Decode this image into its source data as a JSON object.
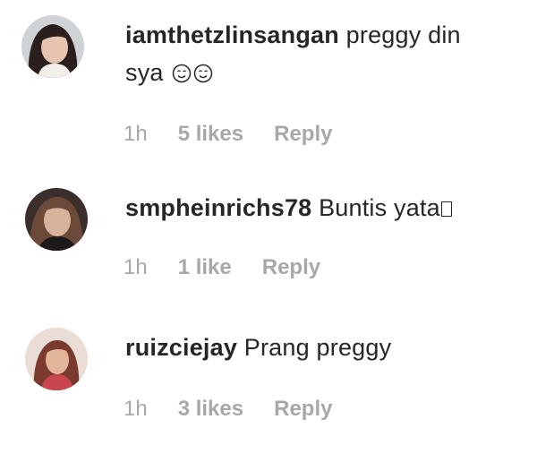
{
  "comments": [
    {
      "username": "iamthetzlinsangan",
      "text_line1": "preggy din",
      "text_line2": "sya",
      "emojis": [
        "smiling-face-emoji",
        "smiling-face-emoji"
      ],
      "time": "1h",
      "likes": "5 likes",
      "reply": "Reply"
    },
    {
      "username": "smpheinrichs78",
      "text": "Buntis yata",
      "trailing_glyph": "missing-glyph-box",
      "time": "1h",
      "likes": "1 like",
      "reply": "Reply"
    },
    {
      "username": "ruizciejay",
      "text": "Prang preggy",
      "time": "1h",
      "likes": "3 likes",
      "reply": "Reply"
    }
  ],
  "colors": {
    "text": "#262626",
    "meta": "#a8a8a8",
    "background": "#ffffff"
  }
}
